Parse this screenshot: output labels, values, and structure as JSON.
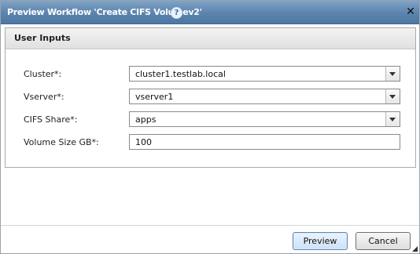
{
  "dialog": {
    "title": "Preview Workflow 'Create CIFS Volumev2'",
    "help_icon": "?",
    "close_icon": "✕"
  },
  "panel": {
    "title": "User Inputs",
    "fields": [
      {
        "label": "Cluster*:",
        "value": "cluster1.testlab.local",
        "type": "combo"
      },
      {
        "label": "Vserver*:",
        "value": "vserver1",
        "type": "combo"
      },
      {
        "label": "CIFS Share*:",
        "value": "apps",
        "type": "combo"
      },
      {
        "label": "Volume Size GB*:",
        "value": "100",
        "type": "text"
      }
    ]
  },
  "buttons": {
    "preview": "Preview",
    "cancel": "Cancel"
  },
  "colors": {
    "titlebar": "#5b83ad",
    "preview_button": "#cde1f5"
  }
}
